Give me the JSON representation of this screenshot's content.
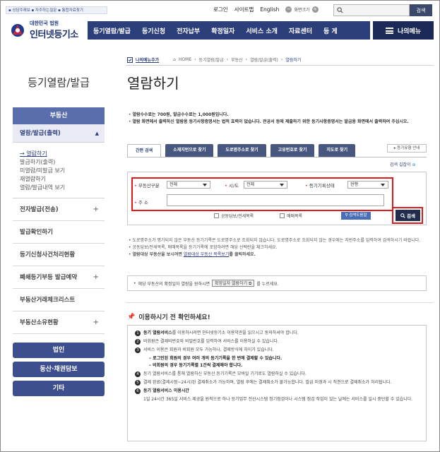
{
  "header": {
    "quicklinks": "▪ 상담주제보 ▪ 자주하는질문 ▪ 통합자료찾기",
    "links": [
      "로그인",
      "사이트맵",
      "English"
    ],
    "zoom_label": "화면크기",
    "search_button": "검색",
    "logo_small": "대한민국 법원",
    "logo_main": "인터넷등기소"
  },
  "nav": {
    "items": [
      "등기열람/발급",
      "등기신청",
      "전자납부",
      "확정일자",
      "서비스 소개",
      "자료센터",
      "등 게"
    ],
    "my_menu": "나의메뉴"
  },
  "sidebar": {
    "title": "등기열람/발급",
    "section": "부동산",
    "active": "열람/발급(출력)",
    "subitems": [
      "열람하기",
      "발급하기(출력)",
      "미열람/미발급 보기",
      "재열람하기",
      "열람/발급내역 보기"
    ],
    "items": [
      {
        "label": "전자발급(전송)",
        "expandable": true
      },
      {
        "label": "발급확인하기",
        "expandable": false
      },
      {
        "label": "등기신청사건처리현황",
        "expandable": false
      },
      {
        "label": "폐쇄등기부등 발급예약",
        "expandable": true
      },
      {
        "label": "부동산거래체크리스트",
        "expandable": false
      },
      {
        "label": "부동산소유현황",
        "expandable": true
      }
    ],
    "buttons": [
      "법인",
      "동산·채권담보",
      "기타"
    ]
  },
  "breadcrumb": {
    "add_menu": "나의메뉴추가",
    "path": [
      "HOME",
      "등기열람/발급",
      "부동산",
      "열람/발급(출력)",
      "열람하기"
    ]
  },
  "page_title": "열람하기",
  "notices": [
    "열람수수료는 700원, 발급수수료는 1,000원입니다.",
    "열람 화면에서 출력하신 열람용 등기사항증명서는 법적 효력이 없습니다. 관공서 등에 제출하기 위한 등기사항증명서는 발급용 화면에서 출력하여 주십시오."
  ],
  "tabs": [
    "간편 검색",
    "소재지번으로 찾기",
    "도로명주소로 찾기",
    "고유번호로 찾기",
    "지도로 찾기"
  ],
  "reg_guide": "등기유형 안내",
  "guide_link": "검색 길잡이",
  "form": {
    "type_label": "부동산구분",
    "type_value": "전체",
    "region_label": "시/도",
    "region_value": "전체",
    "status_label": "등기기록상태",
    "status_value": "현행",
    "address_label": "주 소",
    "chk_joint": "공동담보/전세목록",
    "chk_trade": "매매목록",
    "address_help": "검색도움말",
    "search_button": "검색"
  },
  "notes": [
    "도로명주소가 명기되지 않은 부동산 등기기록은 도로명주소로 조회되지 않습니다. 도로명주소로 조회되지 않는 경우에는 지번주소를 입력하여 검색하시기 바랍니다.",
    "공동담보/전세목록, 매매목록을 등기기록에 포함하려면 해당 선택란을 체크하세요.",
    "열람대상 부동산을 보시려면",
    "열람대상 부동산 목록보기",
    "를 클릭하세요."
  ],
  "infobar": {
    "text1": "해당 부동산의 확정일자 열람을 원하시면",
    "button": "확정일자 열람하기",
    "text2": "를 누르세요."
  },
  "checklist_title": "이용하시기 전 확인하세요!",
  "checklist": [
    {
      "n": "1",
      "bold": "등기 열람서비스",
      "text": "를 이용하시려면 인터넷등기소 이용약관을 읽으시고 동의하셔야 합니다."
    },
    {
      "n": "2",
      "bold": "",
      "text": "비회원은 결제비번호와 비밀번호를 입력하여 서비스를 이용하실 수 있습니다."
    },
    {
      "n": "3",
      "bold": "",
      "text": "서비스 이용은 회원과 비회원 모두 가능하나, 결제방식에 차이가 있습니다."
    },
    {
      "n": "4",
      "bold": "",
      "text": "등기 열람서비스를 통해 열람하신 부동산 등기기록은 모바일 기기로도 열람하실 수 있습니다."
    },
    {
      "n": "5",
      "bold": "",
      "text": "결제 완료(결제시점~24시)된 결제취소가 가능하며, 열람 후에는 결제취소가 불가능합니다. 발급 미경과 시 직권으로 결제취소가 처리됩니다."
    },
    {
      "n": "6",
      "bold": "등기 열람서비스 이용시간",
      "text": ""
    }
  ],
  "checklist_subs": [
    "– 로그인된 회원의 경우 여러 개의 등기기록을 한 번에 결제할 수 있습니다.",
    "– 비회원의 경우 등기기록별 1건씩 결제해야 합니다."
  ],
  "checklist_last": "1일 24시간 365일 서비스 제공을 원칙으로 하나 등기업무 전산시스템 정기점검이나 시스템 점검 작업이 있는 날에는 서비스를 일시 중단할 수 있습니다."
}
